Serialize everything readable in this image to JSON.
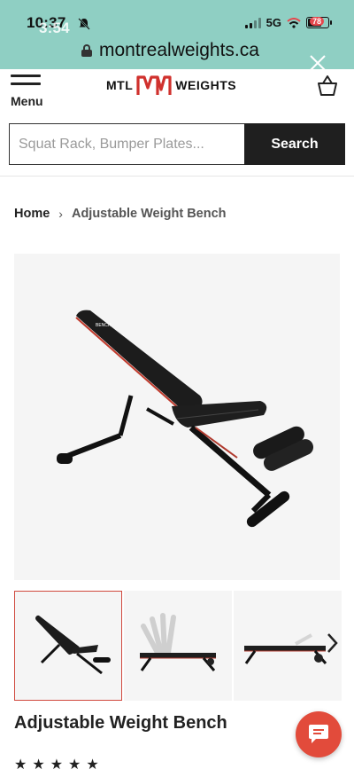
{
  "status_bar": {
    "time": "10:37",
    "time_overlay": "3:54",
    "network": "5G",
    "battery_badge": "78"
  },
  "browser": {
    "url": "montrealweights.ca"
  },
  "header": {
    "menu_label": "Menu",
    "logo_left": "MTL",
    "logo_right": "WEIGHTS",
    "brand_color": "#d0312d"
  },
  "search": {
    "placeholder": "Squat Rack, Bumper Plates...",
    "button_label": "Search"
  },
  "breadcrumb": {
    "home": "Home",
    "separator": "›",
    "current": "Adjustable Weight Bench"
  },
  "product": {
    "title": "Adjustable Weight Bench",
    "thumbnails": [
      "bench-incline",
      "bench-angles",
      "bench-flat"
    ],
    "active_thumbnail": 0,
    "stars": "★★★★★"
  },
  "colors": {
    "chrome_bg": "#8fcfc3",
    "accent_red": "#e24b3b"
  }
}
